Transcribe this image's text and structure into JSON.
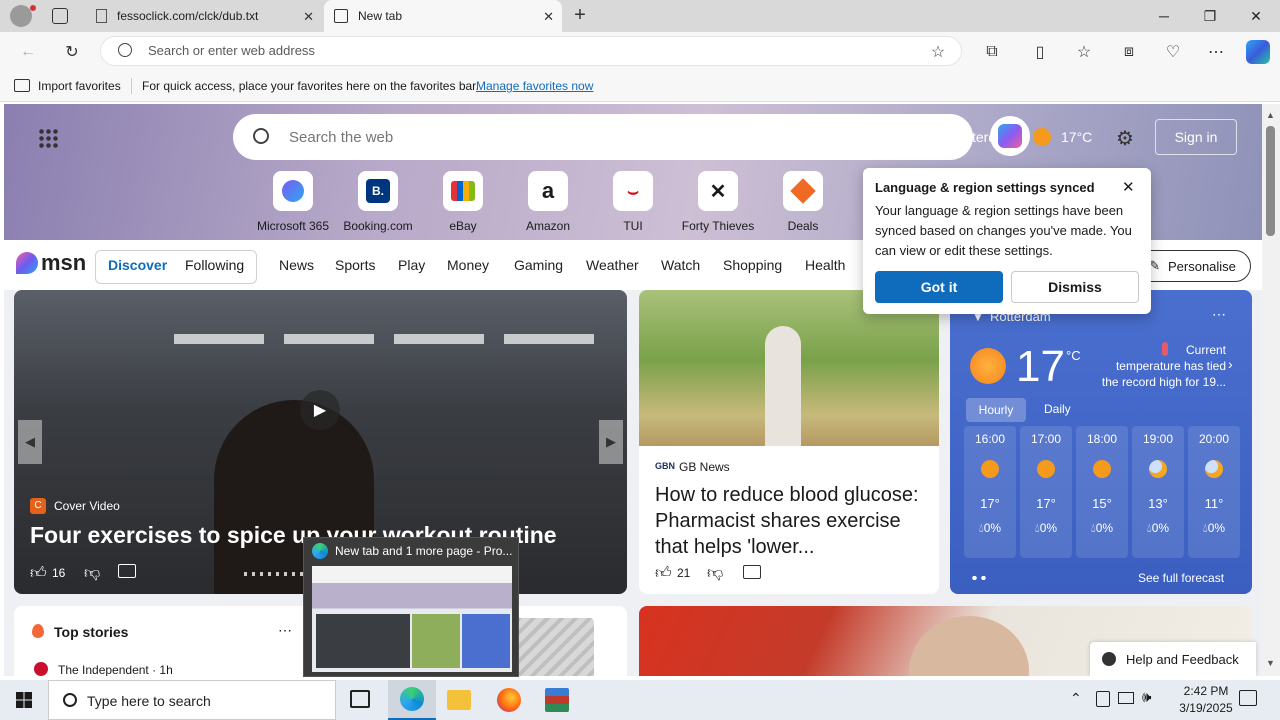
{
  "browser": {
    "tabs": [
      {
        "title": "fessoclick.com/clck/dub.txt"
      },
      {
        "title": "New tab"
      }
    ],
    "address_placeholder": "Search or enter web address",
    "favbar": {
      "import_label": "Import favorites",
      "hint": "For quick access, place your favorites here on the favorites bar.",
      "manage_link": "Manage favorites now"
    }
  },
  "newtab": {
    "search_placeholder": "Search the web",
    "location_partial": "terdam",
    "temperature": "17°C",
    "signin": "Sign in",
    "quick_links": [
      {
        "label": "Microsoft 365",
        "icon": "microsoft365-icon"
      },
      {
        "label": "Booking.com",
        "icon": "booking-icon"
      },
      {
        "label": "eBay",
        "icon": "ebay-icon"
      },
      {
        "label": "Amazon",
        "icon": "amazon-icon"
      },
      {
        "label": "TUI",
        "icon": "tui-icon"
      },
      {
        "label": "Forty Thieves",
        "icon": "forty-thieves-icon"
      },
      {
        "label": "Deals",
        "icon": "deals-icon"
      }
    ]
  },
  "msn": {
    "logo": "msn",
    "seg": [
      "Discover",
      "Following"
    ],
    "nav": [
      "News",
      "Sports",
      "Play",
      "Money",
      "Gaming",
      "Weather",
      "Watch",
      "Shopping",
      "Health"
    ],
    "personalise": "Personalise"
  },
  "popup": {
    "title": "Language & region settings synced",
    "body": "Your language & region settings have been synced based on changes you've made. You can view or edit these settings.",
    "got_it": "Got it",
    "dismiss": "Dismiss"
  },
  "main_card": {
    "source": "Cover Video",
    "headline": "Four exercises to spice up your workout routine",
    "likes": "16"
  },
  "news_card": {
    "source": "GB News",
    "headline": "How to reduce blood glucose: Pharmacist shares exercise that helps 'lower...",
    "likes": "21"
  },
  "weather": {
    "city": "Rotterdam",
    "temp": "17",
    "unit": "°C",
    "alert": "Current temperature has tied the record high for 19...",
    "tabs": [
      "Hourly",
      "Daily"
    ],
    "hours": [
      {
        "time": "16:00",
        "temp": "17°",
        "precip": "0%"
      },
      {
        "time": "17:00",
        "temp": "17°",
        "precip": "0%"
      },
      {
        "time": "18:00",
        "temp": "15°",
        "precip": "0%"
      },
      {
        "time": "19:00",
        "temp": "13°",
        "precip": "0%"
      },
      {
        "time": "20:00",
        "temp": "11°",
        "precip": "0%"
      }
    ],
    "forecast_link": "See full forecast"
  },
  "top_stories": {
    "title": "Top stories",
    "item_source": "The Independent · 1h"
  },
  "thumbnail": {
    "title": "New tab and 1 more page - Pro..."
  },
  "help": {
    "label": "Help and Feedback"
  },
  "taskbar": {
    "search_placeholder": "Type here to search",
    "time": "2:42 PM",
    "date": "3/19/2025"
  }
}
